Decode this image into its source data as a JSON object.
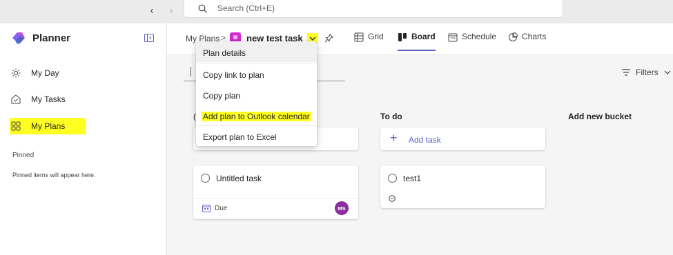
{
  "search": {
    "placeholder": "Search (Ctrl+E)"
  },
  "sidebar": {
    "app_title": "Planner",
    "items": [
      {
        "label": "My Day",
        "icon": "sun-icon"
      },
      {
        "label": "My Tasks",
        "icon": "tasks-icon"
      },
      {
        "label": "My Plans",
        "icon": "grid-icon",
        "highlighted": true
      }
    ],
    "pinned_heading": "Pinned",
    "pinned_empty": "Pinned items will appear here."
  },
  "header": {
    "breadcrumb": "My Plans",
    "breadcrumb_separator": ">",
    "plan_title": "new test task",
    "tabs": [
      {
        "label": "Grid",
        "icon": "grid-table-icon"
      },
      {
        "label": "Board",
        "icon": "board-icon",
        "active": true
      },
      {
        "label": "Schedule",
        "icon": "calendar-icon"
      },
      {
        "label": "Charts",
        "icon": "charts-icon"
      }
    ]
  },
  "toolbar": {
    "filters_label": "Filters"
  },
  "board": {
    "buckets": [
      {
        "title": "",
        "tasks": [
          {
            "title": "Untitled task",
            "due_label": "Due",
            "assignee_initials": "MS"
          }
        ]
      },
      {
        "title": "To do",
        "add_task_label": "Add task",
        "tasks": [
          {
            "title": "test1"
          }
        ]
      }
    ],
    "add_bucket_label": "Add new bucket"
  },
  "plan_menu": {
    "items": [
      {
        "label": "Plan details"
      },
      {
        "label": "Copy link to plan"
      },
      {
        "label": "Copy plan"
      },
      {
        "label": "Add plan to Outlook calendar",
        "highlighted": true
      },
      {
        "label": "Export plan to Excel"
      }
    ]
  },
  "colors": {
    "accent": "#5b5fc7",
    "highlight": "#ffff22",
    "plan_icon": "#d12bd3",
    "avatar": "#8b2f9e"
  }
}
